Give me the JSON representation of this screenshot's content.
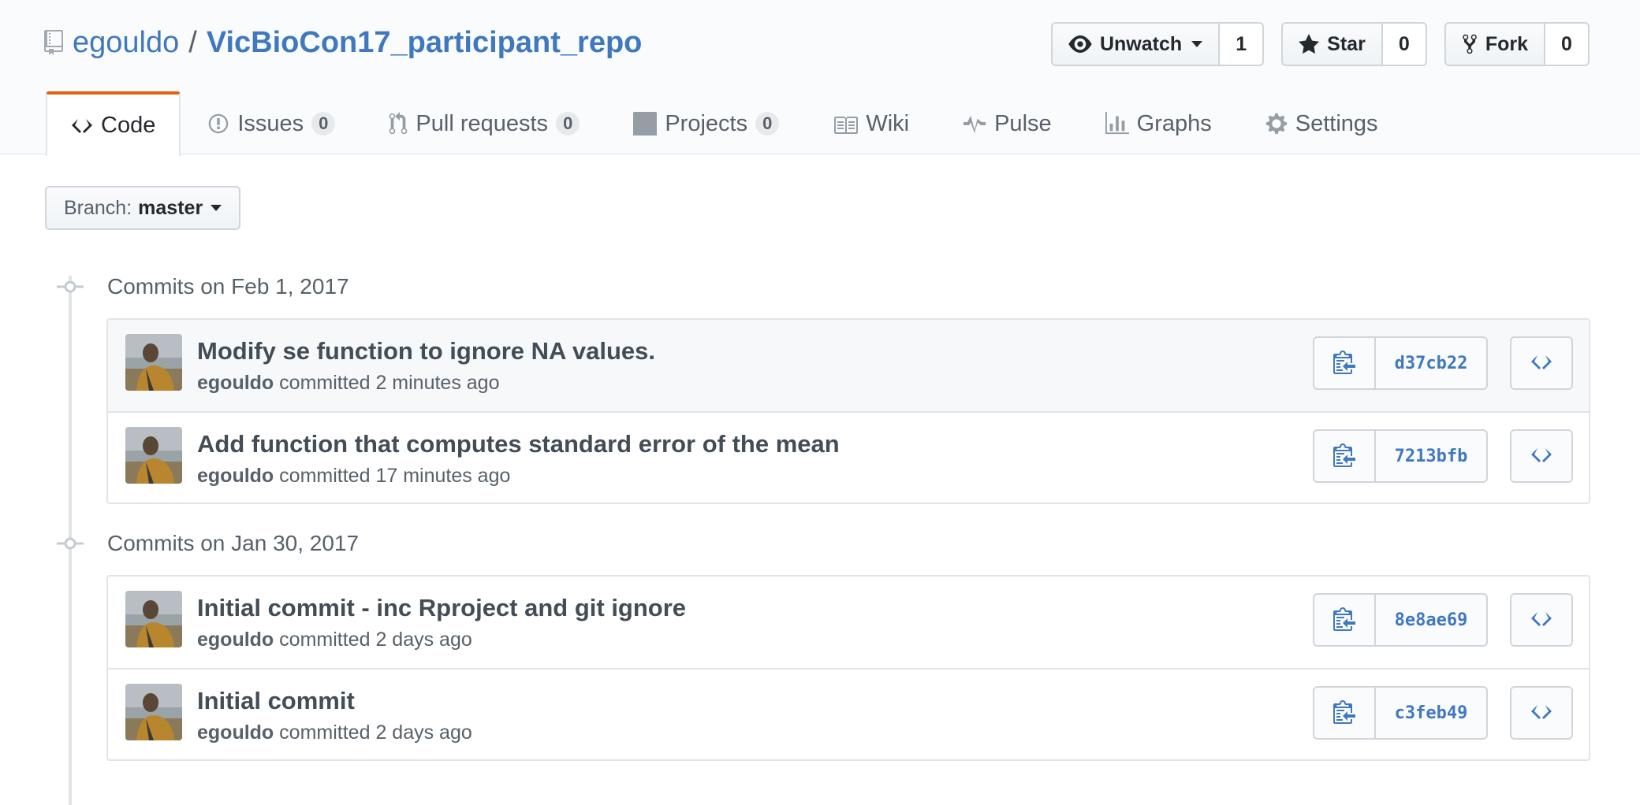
{
  "repo": {
    "owner": "egouldo",
    "separator": "/",
    "name": "VicBioCon17_participant_repo"
  },
  "actions": {
    "watch": {
      "label": "Unwatch",
      "count": "1"
    },
    "star": {
      "label": "Star",
      "count": "0"
    },
    "fork": {
      "label": "Fork",
      "count": "0"
    }
  },
  "nav": {
    "code": "Code",
    "issues": {
      "label": "Issues",
      "count": "0"
    },
    "pulls": {
      "label": "Pull requests",
      "count": "0"
    },
    "projects": {
      "label": "Projects",
      "count": "0"
    },
    "wiki": "Wiki",
    "pulse": "Pulse",
    "graphs": "Graphs",
    "settings": "Settings"
  },
  "branch": {
    "prefix": "Branch:",
    "name": "master"
  },
  "groups": [
    {
      "title": "Commits on Feb 1, 2017",
      "commits": [
        {
          "message": "Modify se function to ignore NA values.",
          "author": "egouldo",
          "verb": "committed",
          "time": "2 minutes ago",
          "sha": "d37cb22"
        },
        {
          "message": "Add function that computes standard error of the mean",
          "author": "egouldo",
          "verb": "committed",
          "time": "17 minutes ago",
          "sha": "7213bfb"
        }
      ]
    },
    {
      "title": "Commits on Jan 30, 2017",
      "commits": [
        {
          "message": "Initial commit - inc Rproject and git ignore",
          "author": "egouldo",
          "verb": "committed",
          "time": "2 days ago",
          "sha": "8e8ae69"
        },
        {
          "message": "Initial commit",
          "author": "egouldo",
          "verb": "committed",
          "time": "2 days ago",
          "sha": "c3feb49"
        }
      ]
    }
  ],
  "colors": {
    "link": "#4078c0",
    "selected_tab_accent": "#e36209",
    "muted_text": "#586069"
  }
}
